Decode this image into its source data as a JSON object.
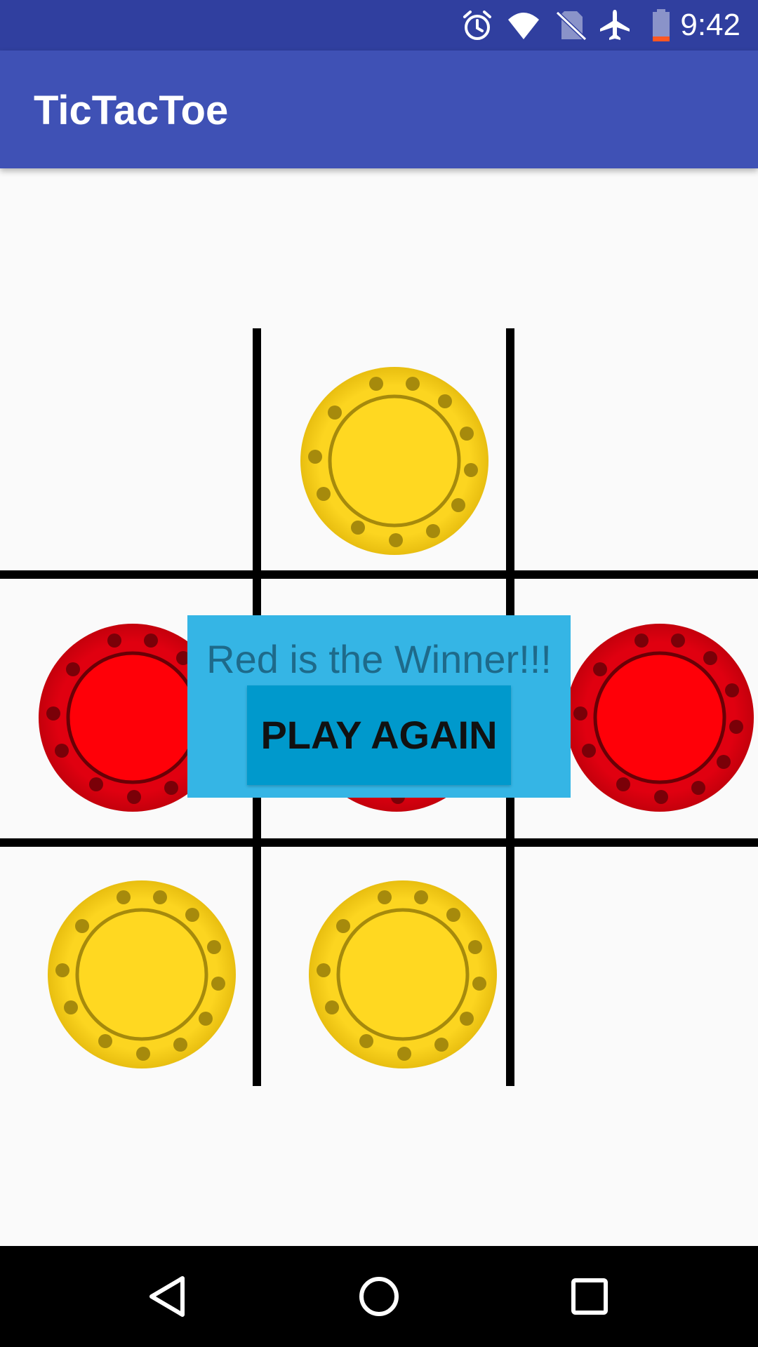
{
  "status_bar": {
    "time": "9:42",
    "icons": [
      "alarm-icon",
      "wifi-icon",
      "no-sim-icon",
      "airplane-mode-icon",
      "battery-low-icon"
    ]
  },
  "app_bar": {
    "title": "TicTacToe"
  },
  "board": {
    "cells": [
      [
        "",
        "yellow",
        ""
      ],
      [
        "red",
        "red",
        "red"
      ],
      [
        "yellow",
        "yellow",
        ""
      ]
    ]
  },
  "dialog": {
    "message": "Red is the Winner!!!",
    "button_label": "PLAY AGAIN"
  },
  "nav_bar": {
    "buttons": [
      "back-icon",
      "home-icon",
      "recents-icon"
    ]
  },
  "colors": {
    "status_bar": "#303f9f",
    "app_bar": "#3f51b5",
    "dialog_bg": "#35b5e5",
    "button_bg": "#0099cc",
    "red_piece": "#ff0008",
    "yellow_piece": "#ffd821"
  }
}
